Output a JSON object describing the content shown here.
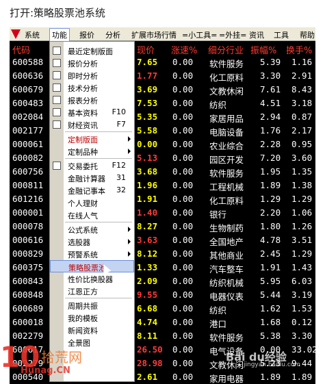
{
  "caption": "打开:策略股票池系统",
  "menubar": {
    "items": [
      "系统",
      "功能",
      "报价",
      "分析",
      "扩展市场行情",
      "=小工具=",
      "=外挂=",
      "资讯",
      "工具",
      "帮助"
    ],
    "active_index": 1
  },
  "table": {
    "headers": [
      "代码",
      "现价",
      "涨速%",
      "细分行业",
      "振幅%",
      "换手%"
    ],
    "rows": [
      {
        "code": "600588",
        "price": "7.65",
        "chg": "0.00",
        "ind": "软件服务",
        "amp": "5.39",
        "turn": "1.16",
        "price_red": false
      },
      {
        "code": "600636",
        "price": "1.77",
        "chg": "0.00",
        "ind": "化工原料",
        "amp": "3.30",
        "turn": "2.91",
        "price_red": true
      },
      {
        "code": "600679",
        "price": "3.69",
        "chg": "0.00",
        "ind": "文教休闲",
        "amp": "7.61",
        "turn": "8.43",
        "price_red": false
      },
      {
        "code": "600483",
        "price": "7.53",
        "chg": "0.00",
        "ind": "纺织",
        "amp": "4.51",
        "turn": "3.18",
        "price_red": false
      },
      {
        "code": "002084",
        "price": "5.35",
        "chg": "0.00",
        "ind": "家居用品",
        "amp": "2.94",
        "turn": "0.87",
        "price_red": false
      },
      {
        "code": "002177",
        "price": "5.58",
        "chg": "0.00",
        "ind": "电脑设备",
        "amp": "1.76",
        "turn": "2.17",
        "price_red": false
      },
      {
        "code": "000061",
        "price": "0.00",
        "chg": "0.00",
        "ind": "农业综合",
        "amp": "2.28",
        "turn": "0.95",
        "price_red": false
      },
      {
        "code": "600082",
        "price": "5.13",
        "chg": "0.00",
        "ind": "园区开发",
        "amp": "7.20",
        "turn": "3.60",
        "price_red": true
      },
      {
        "code": "600756",
        "price": "3.68",
        "chg": "0.00",
        "ind": "软件服务",
        "amp": "1.95",
        "turn": "1.35",
        "price_red": false
      },
      {
        "code": "000811",
        "price": "1.96",
        "chg": "0.00",
        "ind": "工程机械",
        "amp": "1.89",
        "turn": "1.38",
        "price_red": false
      },
      {
        "code": "601216",
        "price": "1.91",
        "chg": "0.00",
        "ind": "化工原料",
        "amp": "1.29",
        "turn": "1.29",
        "price_red": false
      },
      {
        "code": "000001",
        "price": "1.40",
        "chg": "0.00",
        "ind": "银行",
        "amp": "2.20",
        "turn": "1.06",
        "price_red": true
      },
      {
        "code": "000078",
        "price": "8.27",
        "chg": "0.00",
        "ind": "生物制药",
        "amp": "1.80",
        "turn": "1.26",
        "price_red": false
      },
      {
        "code": "000616",
        "price": "3.63",
        "chg": "0.00",
        "ind": "全国地产",
        "amp": "4.78",
        "turn": "3.51",
        "price_red": true
      },
      {
        "code": "000829",
        "price": "8.12",
        "chg": "0.00",
        "ind": "其他商业",
        "amp": "2.45",
        "turn": "1.29",
        "price_red": false
      },
      {
        "code": "600375",
        "price": "1.33",
        "chg": "0.00",
        "ind": "汽车整车",
        "amp": "1.91",
        "turn": "1.43",
        "price_red": false
      },
      {
        "code": "600843",
        "price": "2.09",
        "chg": "0.00",
        "ind": "纺织机械",
        "amp": "5.95",
        "turn": "6.03",
        "price_red": false
      },
      {
        "code": "600848",
        "price": "9.55",
        "chg": "0.00",
        "ind": "电器仪表",
        "amp": "5.44",
        "turn": "3.19",
        "price_red": true
      },
      {
        "code": "600689",
        "price": "6.68",
        "chg": "0.00",
        "ind": "纺织",
        "amp": "1.62",
        "turn": "1.53",
        "price_red": false
      },
      {
        "code": "600018",
        "price": "4.74",
        "chg": "0.00",
        "ind": "港口",
        "amp": "1.68",
        "turn": "0.12",
        "price_red": false
      },
      {
        "code": "002279",
        "price": "8.11",
        "chg": "0.00",
        "ind": "软件服务",
        "amp": "5.38",
        "turn": "3.30",
        "price_red": false
      },
      {
        "code": "600617",
        "price": "26.50",
        "chg": "0.00",
        "ind": "电气设备",
        "amp": "0.00",
        "turn": "33.02",
        "price_red": true
      },
      {
        "code": "002279",
        "price": "28.98",
        "chg": "0.00",
        "ind": "文教休闲",
        "amp": "5.23",
        "turn": "9.44",
        "price_red": true
      },
      {
        "code": "000540",
        "price": "2.61",
        "chg": "0.00",
        "ind": "家用电器",
        "amp": "1.89",
        "turn": "1.89",
        "price_red": false
      }
    ]
  },
  "dropdown": {
    "items": [
      {
        "label": "最近定制版面",
        "key": "",
        "arrow": false,
        "red": false,
        "icon": "layout-icon"
      },
      {
        "label": "报价分析",
        "key": "",
        "arrow": false,
        "red": false,
        "icon": "grid-icon"
      },
      {
        "label": "即时分析",
        "key": "",
        "arrow": false,
        "red": false,
        "icon": "line-chart-icon"
      },
      {
        "label": "技术分析",
        "key": "",
        "arrow": false,
        "red": false,
        "icon": "candlestick-icon"
      },
      {
        "label": "报表分析",
        "key": "",
        "arrow": false,
        "red": false,
        "icon": "report-icon"
      },
      {
        "label": "基本资料",
        "key": "F10",
        "arrow": false,
        "red": false,
        "icon": "f10-icon"
      },
      {
        "label": "财经资讯",
        "key": "F7",
        "arrow": false,
        "red": false,
        "icon": "news-icon"
      },
      {
        "label": "定制版面",
        "key": "",
        "arrow": true,
        "red": true,
        "icon": ""
      },
      {
        "label": "定制品种",
        "key": "",
        "arrow": true,
        "red": false,
        "icon": ""
      },
      {
        "label": "交易委托",
        "key": "F12",
        "arrow": false,
        "red": false,
        "icon": "f12-icon"
      },
      {
        "label": "金融计算器",
        "key": "31",
        "arrow": false,
        "red": false,
        "icon": ""
      },
      {
        "label": "金融记事本",
        "key": "32",
        "arrow": false,
        "red": false,
        "icon": ""
      },
      {
        "label": "个人理财",
        "key": "",
        "arrow": false,
        "red": false,
        "icon": ""
      },
      {
        "label": "在线人气",
        "key": "",
        "arrow": false,
        "red": false,
        "icon": ""
      },
      {
        "label": "公式系统",
        "key": "",
        "arrow": true,
        "red": false,
        "icon": ""
      },
      {
        "label": "选股器",
        "key": "",
        "arrow": true,
        "red": false,
        "icon": ""
      },
      {
        "label": "预警系统",
        "key": "",
        "arrow": true,
        "red": false,
        "icon": ""
      },
      {
        "label": "策略股票池",
        "key": "",
        "arrow": false,
        "red": true,
        "icon": "",
        "selected": true
      },
      {
        "label": "性价比换股器",
        "key": "",
        "arrow": false,
        "red": false,
        "icon": ""
      },
      {
        "label": "江恩正方",
        "key": "",
        "arrow": false,
        "red": false,
        "icon": ""
      },
      {
        "label": "周期共振",
        "key": "",
        "arrow": false,
        "red": false,
        "icon": ""
      },
      {
        "label": "我的模板",
        "key": "",
        "arrow": false,
        "red": false,
        "icon": ""
      },
      {
        "label": "新闻资料",
        "key": "",
        "arrow": false,
        "red": false,
        "icon": ""
      },
      {
        "label": "全景图",
        "key": "",
        "arrow": false,
        "red": false,
        "icon": ""
      }
    ]
  },
  "watermarks": {
    "left_big": "10",
    "left_site": "拾荒网",
    "left_url": "Hunag.CN",
    "right_brand": "Bai du经验",
    "right_url": "jingyan.baidu.com"
  }
}
